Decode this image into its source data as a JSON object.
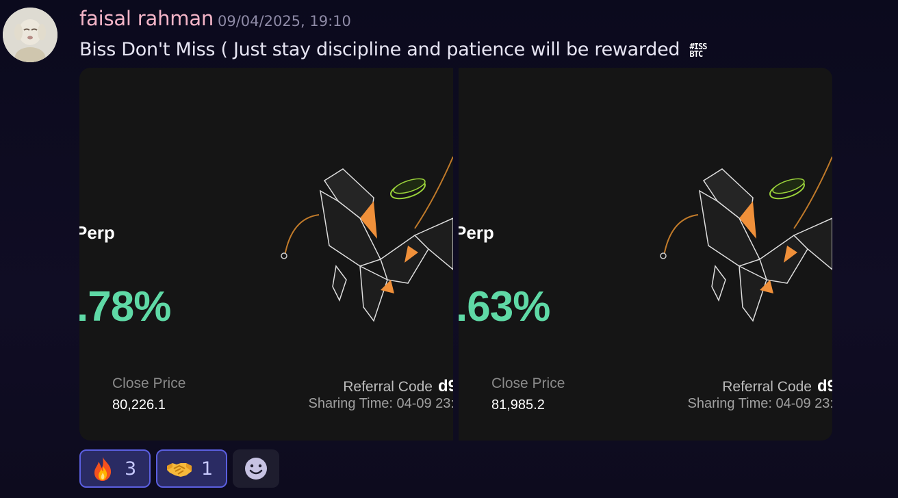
{
  "message": {
    "author": "faisal rahman",
    "timestamp": "09/04/2025, 19:10",
    "text": "Biss Don't Miss ( Just stay discipline and patience will be rewarded",
    "inline_emoji": {
      "line1": "#ISS",
      "line2": "BTC"
    }
  },
  "attachments": [
    {
      "perp_label": "Perp",
      "pnl": ".78%",
      "close_price_label": "Close Price",
      "close_price": "80,226.1",
      "referral_label": "Referral Code",
      "referral_code": "d9",
      "sharing_time": "Sharing Time: 04-09 23:"
    },
    {
      "perp_label": "Perp",
      "pnl": ".63%",
      "close_price_label": "Close Price",
      "close_price": "81,985.2",
      "referral_label": "Referral Code",
      "referral_code": "d9",
      "sharing_time": "Sharing Time: 04-09 23:"
    }
  ],
  "reactions": [
    {
      "icon": "fire-emoji",
      "count": "3"
    },
    {
      "icon": "handshake-emoji",
      "count": "1"
    }
  ],
  "add_reaction_icon": "smiley-icon",
  "colors": {
    "author": "#f4b5c8",
    "pnl_green": "#5fd9a6",
    "reaction_border": "#5b5fe0",
    "accent_orange": "#f0903a",
    "coin_green": "#9ad23a"
  }
}
